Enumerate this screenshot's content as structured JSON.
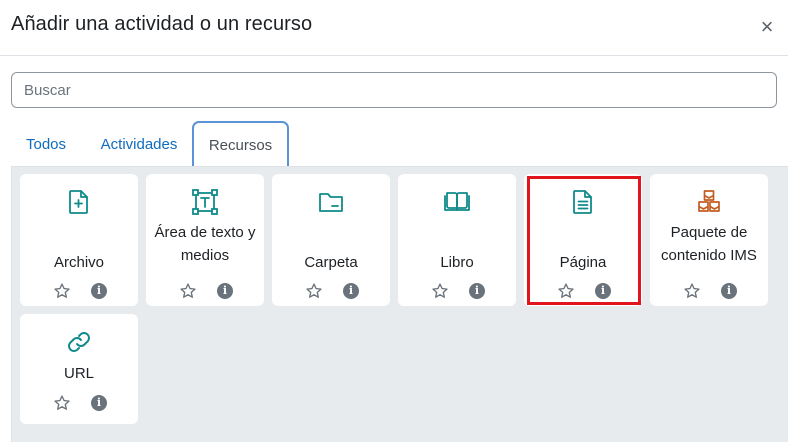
{
  "dialog": {
    "title": "Añadir una actividad o un recurso",
    "close_label": "×"
  },
  "search": {
    "placeholder": "Buscar",
    "value": ""
  },
  "tabs": [
    {
      "label": "Todos",
      "active": false
    },
    {
      "label": "Actividades",
      "active": false
    },
    {
      "label": "Recursos",
      "active": true
    }
  ],
  "items": [
    {
      "label": "Archivo",
      "icon": "file-plus-icon",
      "color": "#0f8a8a"
    },
    {
      "label": "Área de texto y medios",
      "icon": "text-frame-icon",
      "color": "#0f8a8a"
    },
    {
      "label": "Carpeta",
      "icon": "folder-icon",
      "color": "#0f8a8a"
    },
    {
      "label": "Libro",
      "icon": "book-icon",
      "color": "#0f8a8a"
    },
    {
      "label": "Página",
      "icon": "page-icon",
      "color": "#0f8a8a",
      "highlighted": true
    },
    {
      "label": "Paquete de contenido IMS",
      "icon": "cubes-icon",
      "color": "#c25d22"
    },
    {
      "label": "URL",
      "icon": "link-icon",
      "color": "#0f8a8a"
    }
  ],
  "colors": {
    "accent": "#0f6cbf",
    "resource_icon": "#0f8a8a",
    "package_icon": "#c25d22",
    "highlight": "#e1141d",
    "panel_bg": "#e8ebee"
  }
}
